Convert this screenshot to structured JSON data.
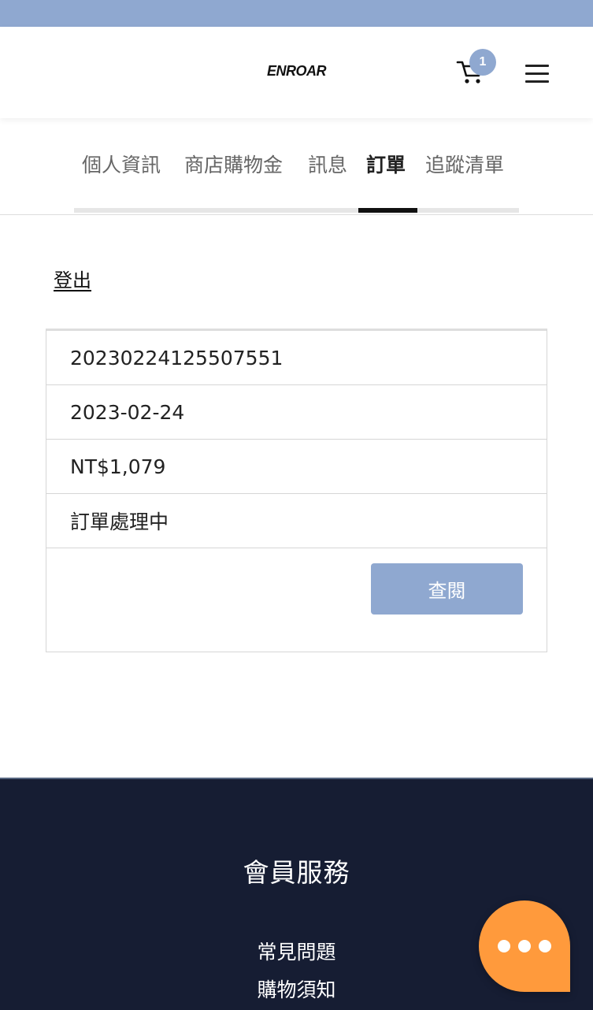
{
  "colors": {
    "top_strip": "#8fa8d0",
    "accent_button": "#8fa8d0",
    "badge": "#8fa8d0",
    "footer_bg": "#161d33",
    "chat_bubble": "#ff9a3c"
  },
  "header": {
    "logo_text": "ENROAR",
    "cart_icon": "shopping-cart-icon",
    "cart_count": "1",
    "menu_icon": "hamburger-menu-icon"
  },
  "tabs": [
    {
      "label": "個人資訊",
      "active": false
    },
    {
      "label": "商店購物金",
      "active": false
    },
    {
      "label": "訊息",
      "active": false
    },
    {
      "label": "訂單",
      "active": true
    },
    {
      "label": "追蹤清單",
      "active": false
    }
  ],
  "account": {
    "logout_label": "登出"
  },
  "order": {
    "number": "20230224125507551",
    "date": "2023-02-24",
    "total": "NT$1,079",
    "status": "訂單處理中",
    "view_label": "查閱"
  },
  "footer": {
    "title": "會員服務",
    "links": [
      "常見問題",
      "購物須知"
    ]
  },
  "chat": {
    "icon": "chat-bubble-icon"
  }
}
